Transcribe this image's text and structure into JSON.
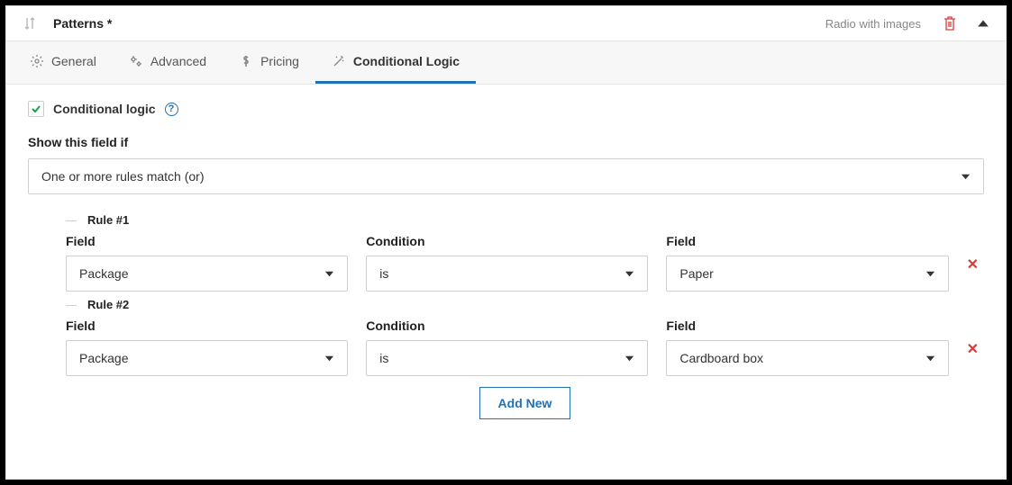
{
  "header": {
    "title": "Patterns *",
    "field_type": "Radio with images"
  },
  "tabs": {
    "general": "General",
    "advanced": "Advanced",
    "pricing": "Pricing",
    "conditional": "Conditional Logic"
  },
  "conditional": {
    "enable_label": "Conditional logic",
    "show_label": "Show this field if",
    "match_mode": "One or more rules match (or)",
    "labels": {
      "field": "Field",
      "condition": "Condition",
      "value": "Field"
    },
    "rules": [
      {
        "legend": "Rule #1",
        "field": "Package",
        "condition": "is",
        "value": "Paper"
      },
      {
        "legend": "Rule #2",
        "field": "Package",
        "condition": "is",
        "value": "Cardboard box"
      }
    ],
    "add_label": "Add New"
  }
}
